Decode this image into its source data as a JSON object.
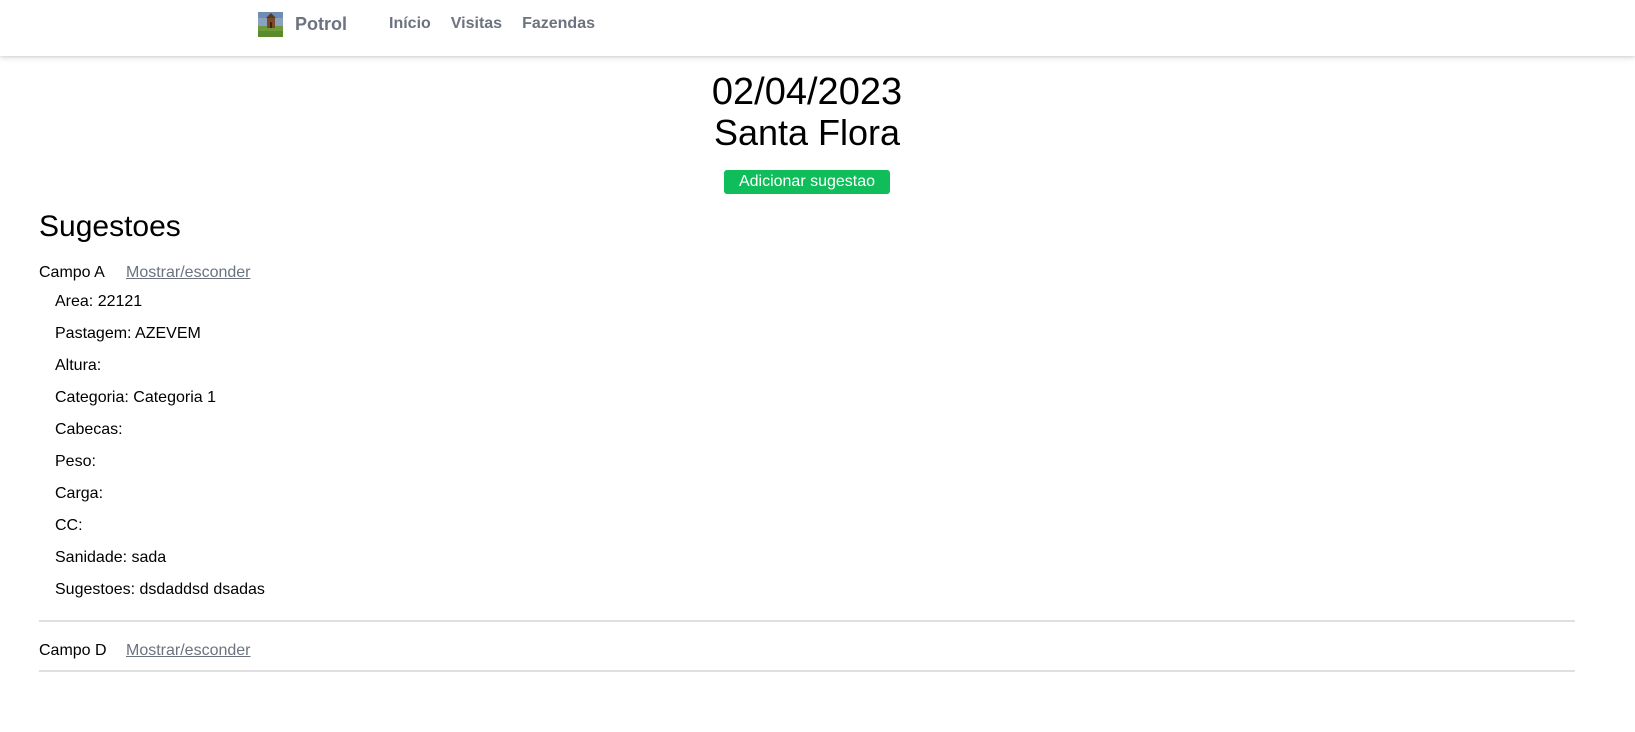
{
  "navbar": {
    "brand": "Potrol",
    "links": [
      {
        "label": "Início"
      },
      {
        "label": "Visitas"
      },
      {
        "label": "Fazendas"
      }
    ]
  },
  "visit": {
    "date": "02/04/2023",
    "farm": "Santa Flora",
    "add_button_label": "Adicionar sugestao",
    "accent_color": "#0fbe5a"
  },
  "suggestions": {
    "title": "Sugestoes",
    "toggle_label": "Mostrar/esconder",
    "campos": [
      {
        "name": "Campo A",
        "expanded": true,
        "details": [
          "Area: 22121",
          "Pastagem: AZEVEM",
          "Altura:",
          "Categoria: Categoria 1",
          "Cabecas:",
          "Peso:",
          "Carga:",
          "CC:",
          "Sanidade: sada",
          "Sugestoes: dsdaddsd dsadas"
        ]
      },
      {
        "name": "Campo D",
        "expanded": false,
        "details": []
      }
    ]
  }
}
